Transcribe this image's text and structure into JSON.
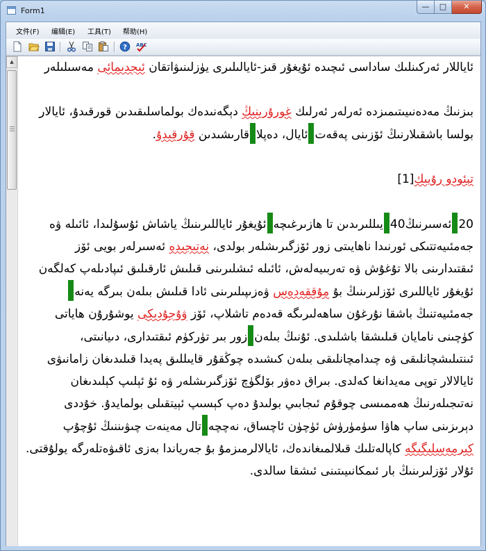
{
  "window": {
    "title": "Form1",
    "caption_buttons": {
      "minimize": "—",
      "maximize": "□",
      "close": "✕"
    },
    "colors": {
      "title_bar": "#c9dcf1",
      "close_button": "#d5634a"
    }
  },
  "menu": {
    "items": [
      {
        "label": "文件(F)"
      },
      {
        "label": "编辑(E)"
      },
      {
        "label": "工具(T)"
      },
      {
        "label": "帮助(H)"
      }
    ]
  },
  "toolbar": {
    "buttons": [
      "new-file-icon",
      "open-folder-icon",
      "save-icon",
      "cut-icon",
      "copy-icon",
      "paste-icon",
      "help-icon",
      "spell-check-icon"
    ]
  },
  "editor": {
    "colors": {
      "text": "#000000",
      "misspelled": "#e02020",
      "marker": "#168a16"
    },
    "p1": {
      "a": "ئاياللار ئەركىنلىك ساداسى ئىچىدە ئۇيغۇر قىز-ئايالىلىرى يۈزلىنىۋاتقان ",
      "e1": "ئىجدىمائى",
      "b": " مەسىلىلەر"
    },
    "p2": {
      "a": "بىزنىڭ مەدەنىيىتىمىزدە ئەرلەر ئەرلىك ",
      "e1": "غورۇرىنىڭ",
      "b": " دېگەنىدەك بولماسلىقىدىن قورقىدۇ، ئايالار بولسا باشقىلارنىڭ ئۆزىنى پەقەت",
      "c": "ئايال، دەپلا",
      "d": "قارىشىدىن ",
      "e2": "قۇرقىدۇ",
      "f": "."
    },
    "heading": {
      "a": "تېئودو رۇيىك",
      "ref": "[1]"
    },
    "p3": {
      "s1": "20",
      "s2": "ئەسىرنىڭ",
      "s3": "40",
      "s4": "يىللىرىدىن تا ھازىرغىچە",
      "s5": "ئۇيغۇر ئاياللىرىنىڭ ياشاش ئۇسۇلىدا، ئائىلە ۋە جەمئىيەتتىكى ئورنىدا ناھايىتى زور ئۆزگىرىشلەر بولدى، ",
      "e1": "نەتىجىدە",
      "s6": " ئەسىرلەر بويى ئۆز ئىقتىدارىنى بالا تۇغۇش ۋە تەربىيەلەش، ئائىلە ئىشلىرىنى قىلىش ئارقىلىق ئىپادىلەپ كەلگەن ئۇيغۇر ئاياللىرى ئۆزلىرىنىڭ بۇ ",
      "e2": "مۇققەدەس",
      "s7": " ۋەزىپىلىرىنى ئادا قىلىش بىلەن بىرگە يەنە",
      "s8": "جەمئىيەتنىڭ باشقا نۇرغۇن ساھەلىرىگە قەدەم تاشلاپ، ئۆز ",
      "e3": "ۋۇجۇدىكى",
      "s9": " يوشۇرۇن ھاياتى كۈچىنى نامايان قىلىشقا باشلىدى. ئۇنىڭ بىلەن",
      "s10": "زور بىر تۈركۈم ئىقتىدارى، دىيانىتى، ئىنتىلىشچانلىقى ۋە چىدامچانلىقى بىلەن كىشىدە چوڭقۇر قايىللىق پەيدا قىلىدىغان زامانىۋى ئايالالار توپى مەيدانغا كەلدى. بىراق دەۋر بۆلگۈچ ئۆزگىرىشلەر ۋە ئۇ ئېلىپ كېلىدىغان نەتىجىلەرنىڭ ھەممىسى چوقۇم ئىجابىي بولىدۇ دەپ كېسىپ ئېيتقىلى بولمايدۇ. خۇددى دېرىزىنى ساپ ھاۋا سۈمۈرۈش ئۈچۈن ئاچساق، نەچچە",
      "s11": "تال مەينەت چىۋىننىڭ ئۇچۇپ ",
      "e4": "كىرمەسلىگىگە",
      "s12": " كاپالەتلىك قىلالمىغاندەك، ئايالالرمىزمۇ بۇ جەرياندا بەزى ئاقىۋەتلەرگە يولۇقتى. ئۇلار ئۆزلىرىنىڭ بار ئىمكانىيىتىنى ئىشقا سالدى."
    }
  }
}
